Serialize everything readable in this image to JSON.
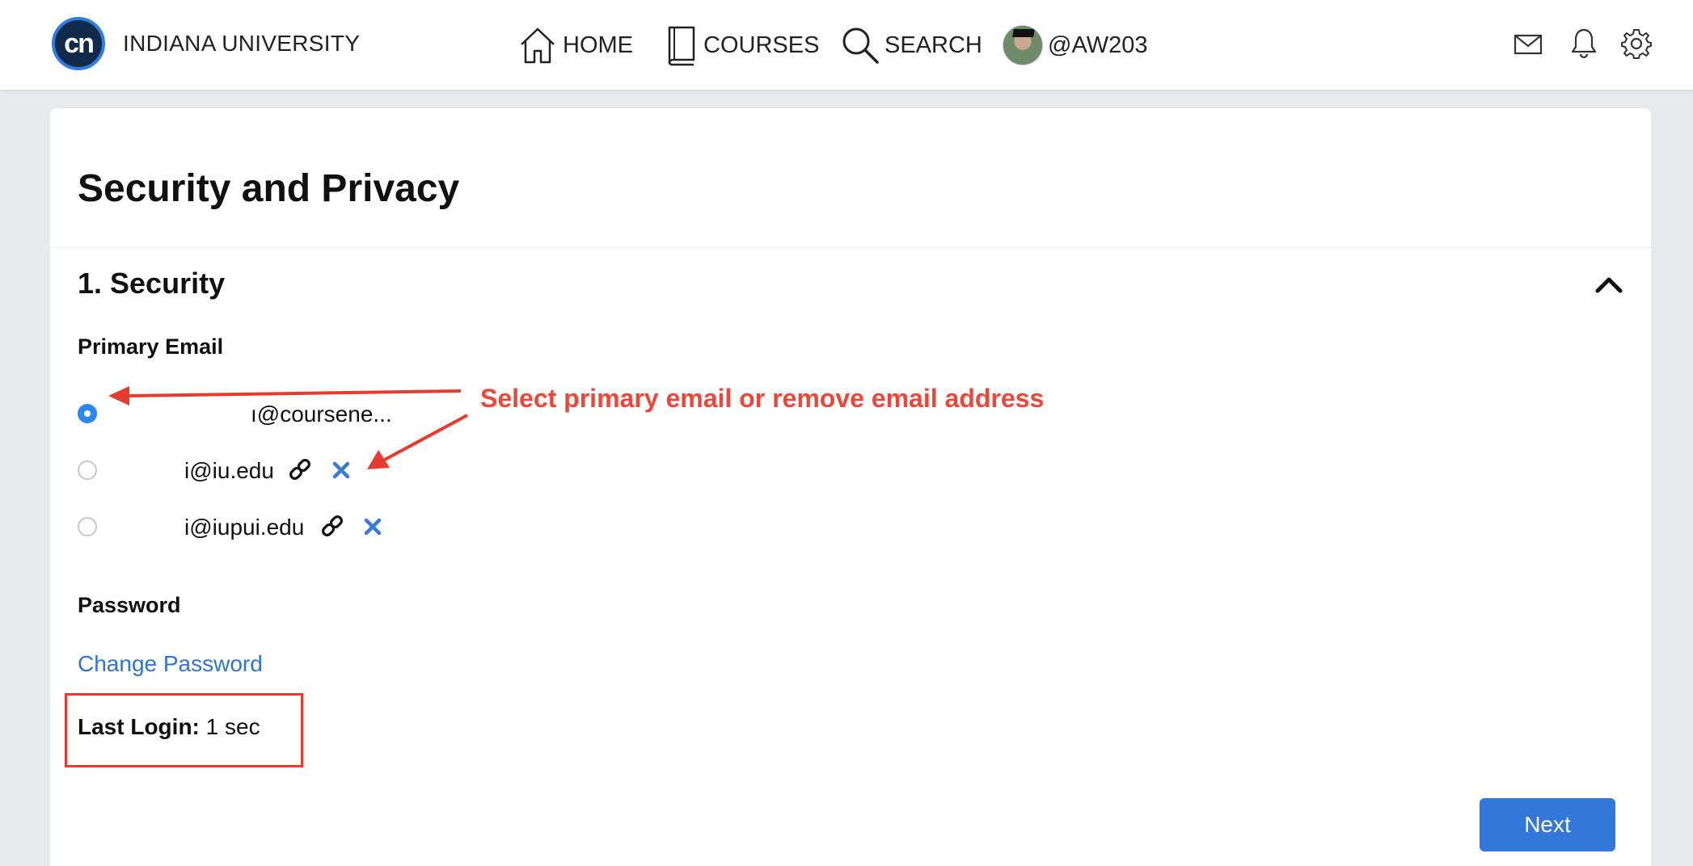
{
  "header": {
    "logo_text": "cn",
    "org_name": "INDIANA UNIVERSITY",
    "nav": {
      "home": "HOME",
      "courses": "COURSES",
      "search": "SEARCH",
      "profile": "@AW203"
    },
    "icons": [
      "house-icon",
      "book-icon",
      "magnifier-icon",
      "mail-icon",
      "bell-icon",
      "gear-icon"
    ]
  },
  "page": {
    "title": "Security and Privacy"
  },
  "security": {
    "section_title": "1. Security",
    "primary_email_label": "Primary Email",
    "emails": [
      {
        "address": "ı@coursene...",
        "selected": true
      },
      {
        "address": "i@iu.edu",
        "selected": false
      },
      {
        "address": "i@iupui.edu",
        "selected": false
      }
    ],
    "password_label": "Password",
    "change_password": "Change Password",
    "last_login_label": "Last Login:",
    "last_login_value": " 1 sec"
  },
  "annotation": {
    "text": "Select primary email or remove email address",
    "color": "#f0463a"
  },
  "footer": {
    "next_label": "Next"
  },
  "colors": {
    "accent": "#3378d8",
    "link": "#2f74d0",
    "radio_selected": "#2d86f0",
    "annotation_red": "#e63b2e"
  }
}
